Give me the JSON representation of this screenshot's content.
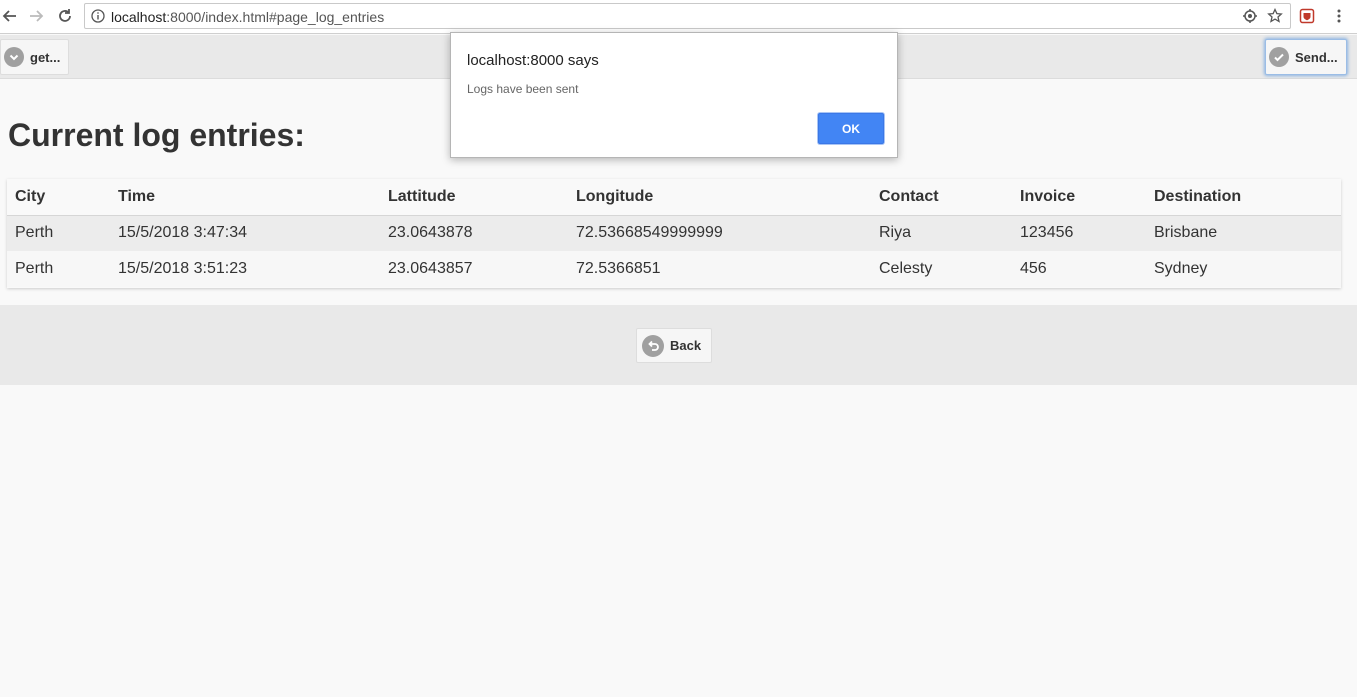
{
  "browser": {
    "url_host": "localhost",
    "url_rest": ":8000/index.html#page_log_entries"
  },
  "header": {
    "left_button_label": "get...",
    "right_button_label": "Send..."
  },
  "page": {
    "title": "Current log entries:"
  },
  "table": {
    "columns": [
      "City",
      "Time",
      "Lattitude",
      "Longitude",
      "Contact",
      "Invoice",
      "Destination"
    ],
    "rows": [
      [
        "Perth",
        "15/5/2018 3:47:34",
        "23.0643878",
        "72.53668549999999",
        "Riya",
        "123456",
        "Brisbane"
      ],
      [
        "Perth",
        "15/5/2018 3:51:23",
        "23.0643857",
        "72.5366851",
        "Celesty",
        "456",
        "Sydney"
      ]
    ]
  },
  "footer": {
    "back_label": "Back"
  },
  "dialog": {
    "title": "localhost:8000 says",
    "message": "Logs have been sent",
    "ok_label": "OK"
  },
  "colors": {
    "dialog_ok": "#4285f4",
    "header_bar": "#e9e9e9",
    "icon_grey": "#a0a0a0"
  },
  "icons": {
    "back_nav": "arrow-left-icon",
    "forward_nav": "arrow-right-icon",
    "reload": "reload-icon",
    "info": "info-icon",
    "location": "location-icon",
    "bookmark": "star-icon",
    "extension": "shield-extension-icon",
    "menu": "kebab-menu-icon",
    "get_button": "chevron-down-circle-icon",
    "send_button": "check-circle-icon",
    "back_button": "back-arrow-circle-icon"
  }
}
